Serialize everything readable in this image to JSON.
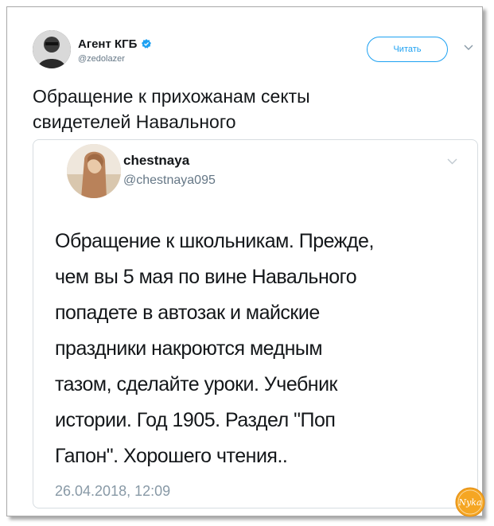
{
  "author": {
    "name": "Агент КГБ",
    "handle": "@zedolazer",
    "verified": true
  },
  "follow_button_label": "Читать",
  "tweet": {
    "text_lines": [
      "Обращение к прихожанам секты",
      "свидетелей Навального"
    ]
  },
  "quoted_tweet": {
    "name": "chestnaya",
    "handle": "@chestnaya095",
    "text_lines": [
      "Обращение к школьникам. Прежде,",
      "чем вы 5 мая по вине Навального",
      "попадете в автозак и майские",
      "праздники накроются медным",
      "тазом, сделайте уроки. Учебник",
      "истории. Год 1905. Раздел \"Поп",
      "Гапон\". Хорошего чтения.."
    ],
    "timestamp": "26.04.2018, 12:09"
  },
  "watermark_text": "Nyka",
  "colors": {
    "accent": "#1da1f2",
    "text": "#14171a",
    "muted": "#657786",
    "watermark": "#f5a623"
  },
  "icons": {
    "verified": "verified-badge-icon",
    "caret": "chevron-down-icon"
  }
}
